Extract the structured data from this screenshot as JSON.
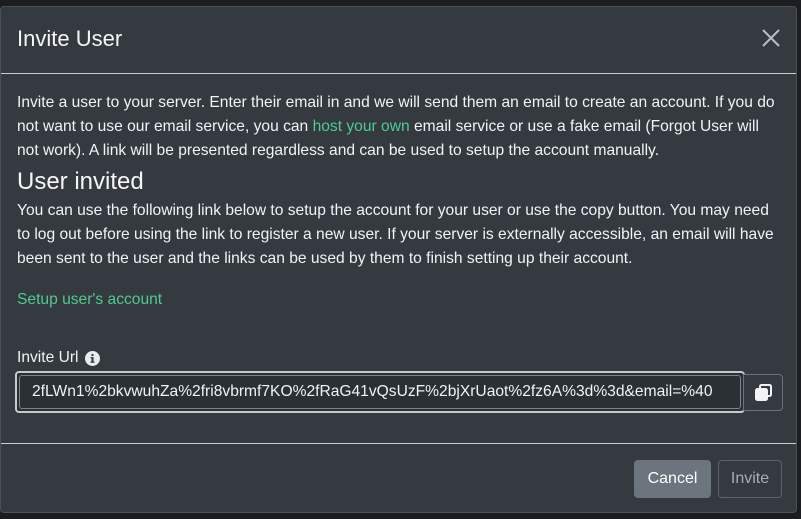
{
  "modal": {
    "title": "Invite User",
    "close_icon": "close-icon"
  },
  "intro": {
    "text_before_link": "Invite a user to your server. Enter their email in and we will send them an email to create an account. If you do not want to use our email service, you can ",
    "link_text": "host your own",
    "text_after_link": " email service or use a fake email (Forgot User will not work). A link will be presented regardless and can be used to setup the account manually."
  },
  "invited": {
    "heading": "User invited",
    "description": "You can use the following link below to setup the account for your user or use the copy button. You may need to log out before using the link to register a new user. If your server is externally accessible, an email will have been sent to the user and the links can be used by them to finish setting up their account.",
    "setup_link": "Setup user's account"
  },
  "invite_url": {
    "label": "Invite Url",
    "label_icon": "info-icon",
    "value": "2fLWn1%2bkvwuhZa%2fri8vbrmf7KO%2fRaG41vQsUzF%2bjXrUaot%2fz6A%3d%3d&email=%40",
    "copy_icon": "copy-icon"
  },
  "footer": {
    "cancel_label": "Cancel",
    "invite_label": "Invite"
  },
  "colors": {
    "modal_bg": "#343a40",
    "link": "#4ecb8f",
    "cancel_bg": "#6c757d"
  }
}
